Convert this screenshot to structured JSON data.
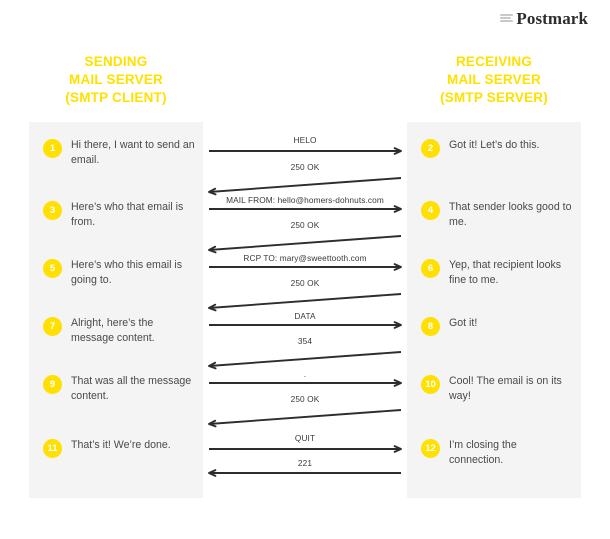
{
  "brand": {
    "name": "Postmark",
    "mark": "stacked-lines-icon"
  },
  "columns": {
    "left": {
      "title_line1": "SENDING",
      "title_line2": "MAIL SERVER",
      "title_line3": "(SMTP CLIENT)"
    },
    "right": {
      "title_line1": "RECEIVING",
      "title_line2": "MAIL SERVER",
      "title_line3": "(SMTP SERVER)"
    }
  },
  "colors": {
    "accent": "#ffe000",
    "panel": "#f4f4f4",
    "text": "#4a4a4a",
    "arrow": "#2d2d2d"
  },
  "left_steps": [
    {
      "number": "1",
      "text": "Hi there, I want to send an email."
    },
    {
      "number": "3",
      "text": "Here’s who that email is from."
    },
    {
      "number": "5",
      "text": "Here’s who this email is going to."
    },
    {
      "number": "7",
      "text": "Alright, here’s the message content."
    },
    {
      "number": "9",
      "text": "That was all the message content."
    },
    {
      "number": "11",
      "text": "That’s it! We’re done."
    }
  ],
  "right_steps": [
    {
      "number": "2",
      "text": "Got it! Let’s do this."
    },
    {
      "number": "4",
      "text": "That sender looks good to me."
    },
    {
      "number": "6",
      "text": "Yep, that recipient looks fine to me."
    },
    {
      "number": "8",
      "text": "Got it!"
    },
    {
      "number": "10",
      "text": "Cool! The email is on its way!"
    },
    {
      "number": "12",
      "text": "I’m closing the connection."
    }
  ],
  "messages": [
    {
      "label": "HELO",
      "direction": "right",
      "shape": "straight"
    },
    {
      "label": "250 OK",
      "direction": "left",
      "shape": "slanted"
    },
    {
      "label": "MAIL FROM: hello@homers-dohnuts.com",
      "direction": "right",
      "shape": "straight"
    },
    {
      "label": "250 OK",
      "direction": "left",
      "shape": "slanted"
    },
    {
      "label": "RCP TO: mary@sweettooth.com",
      "direction": "right",
      "shape": "straight"
    },
    {
      "label": "250 OK",
      "direction": "left",
      "shape": "slanted"
    },
    {
      "label": "DATA",
      "direction": "right",
      "shape": "straight"
    },
    {
      "label": "354",
      "direction": "left",
      "shape": "slanted"
    },
    {
      "label": ".",
      "direction": "right",
      "shape": "straight"
    },
    {
      "label": "250 OK",
      "direction": "left",
      "shape": "slanted"
    },
    {
      "label": "QUIT",
      "direction": "right",
      "shape": "straight"
    },
    {
      "label": "221",
      "direction": "left",
      "shape": "straight"
    }
  ]
}
